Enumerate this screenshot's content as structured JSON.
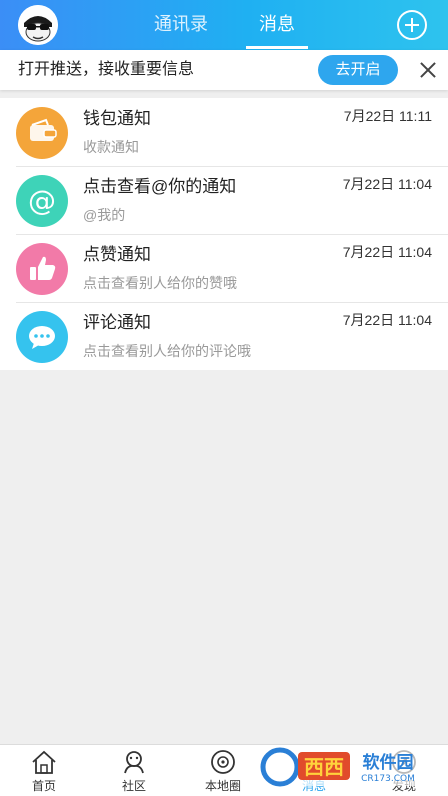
{
  "header": {
    "tabs": [
      {
        "label": "通讯录",
        "active": false
      },
      {
        "label": "消息",
        "active": true
      }
    ],
    "accent_start": "#3b8ef6",
    "accent_end": "#2ec3ee"
  },
  "banner": {
    "text": "打开推送，接收重要信息",
    "button_label": "去开启"
  },
  "messages": [
    {
      "title": "钱包通知",
      "subtitle": "收款通知",
      "time": "7月22日 11:11",
      "icon": "wallet-icon",
      "color": "#f4a53a"
    },
    {
      "title": "点击查看@你的通知",
      "subtitle": "@我的",
      "time": "7月22日 11:04",
      "icon": "at-sign-icon",
      "color": "#3ed3b8"
    },
    {
      "title": "点赞通知",
      "subtitle": "点击查看别人给你的赞哦",
      "time": "7月22日 11:04",
      "icon": "thumbs-up-icon",
      "color": "#f27aa8"
    },
    {
      "title": "评论通知",
      "subtitle": "点击查看别人给你的评论哦",
      "time": "7月22日 11:04",
      "icon": "comment-bubble-icon",
      "color": "#35c3ee"
    }
  ],
  "bottom_nav": [
    {
      "label": "首页",
      "icon": "home-icon",
      "active": false
    },
    {
      "label": "社区",
      "icon": "community-icon",
      "active": false
    },
    {
      "label": "本地圈",
      "icon": "local-circle-icon",
      "active": false
    },
    {
      "label": "消息",
      "icon": "message-icon",
      "active": true
    },
    {
      "label": "发现",
      "icon": "discover-icon",
      "active": false
    }
  ],
  "watermark": {
    "text": "西西软件园",
    "url_text": "CR173.COM"
  }
}
